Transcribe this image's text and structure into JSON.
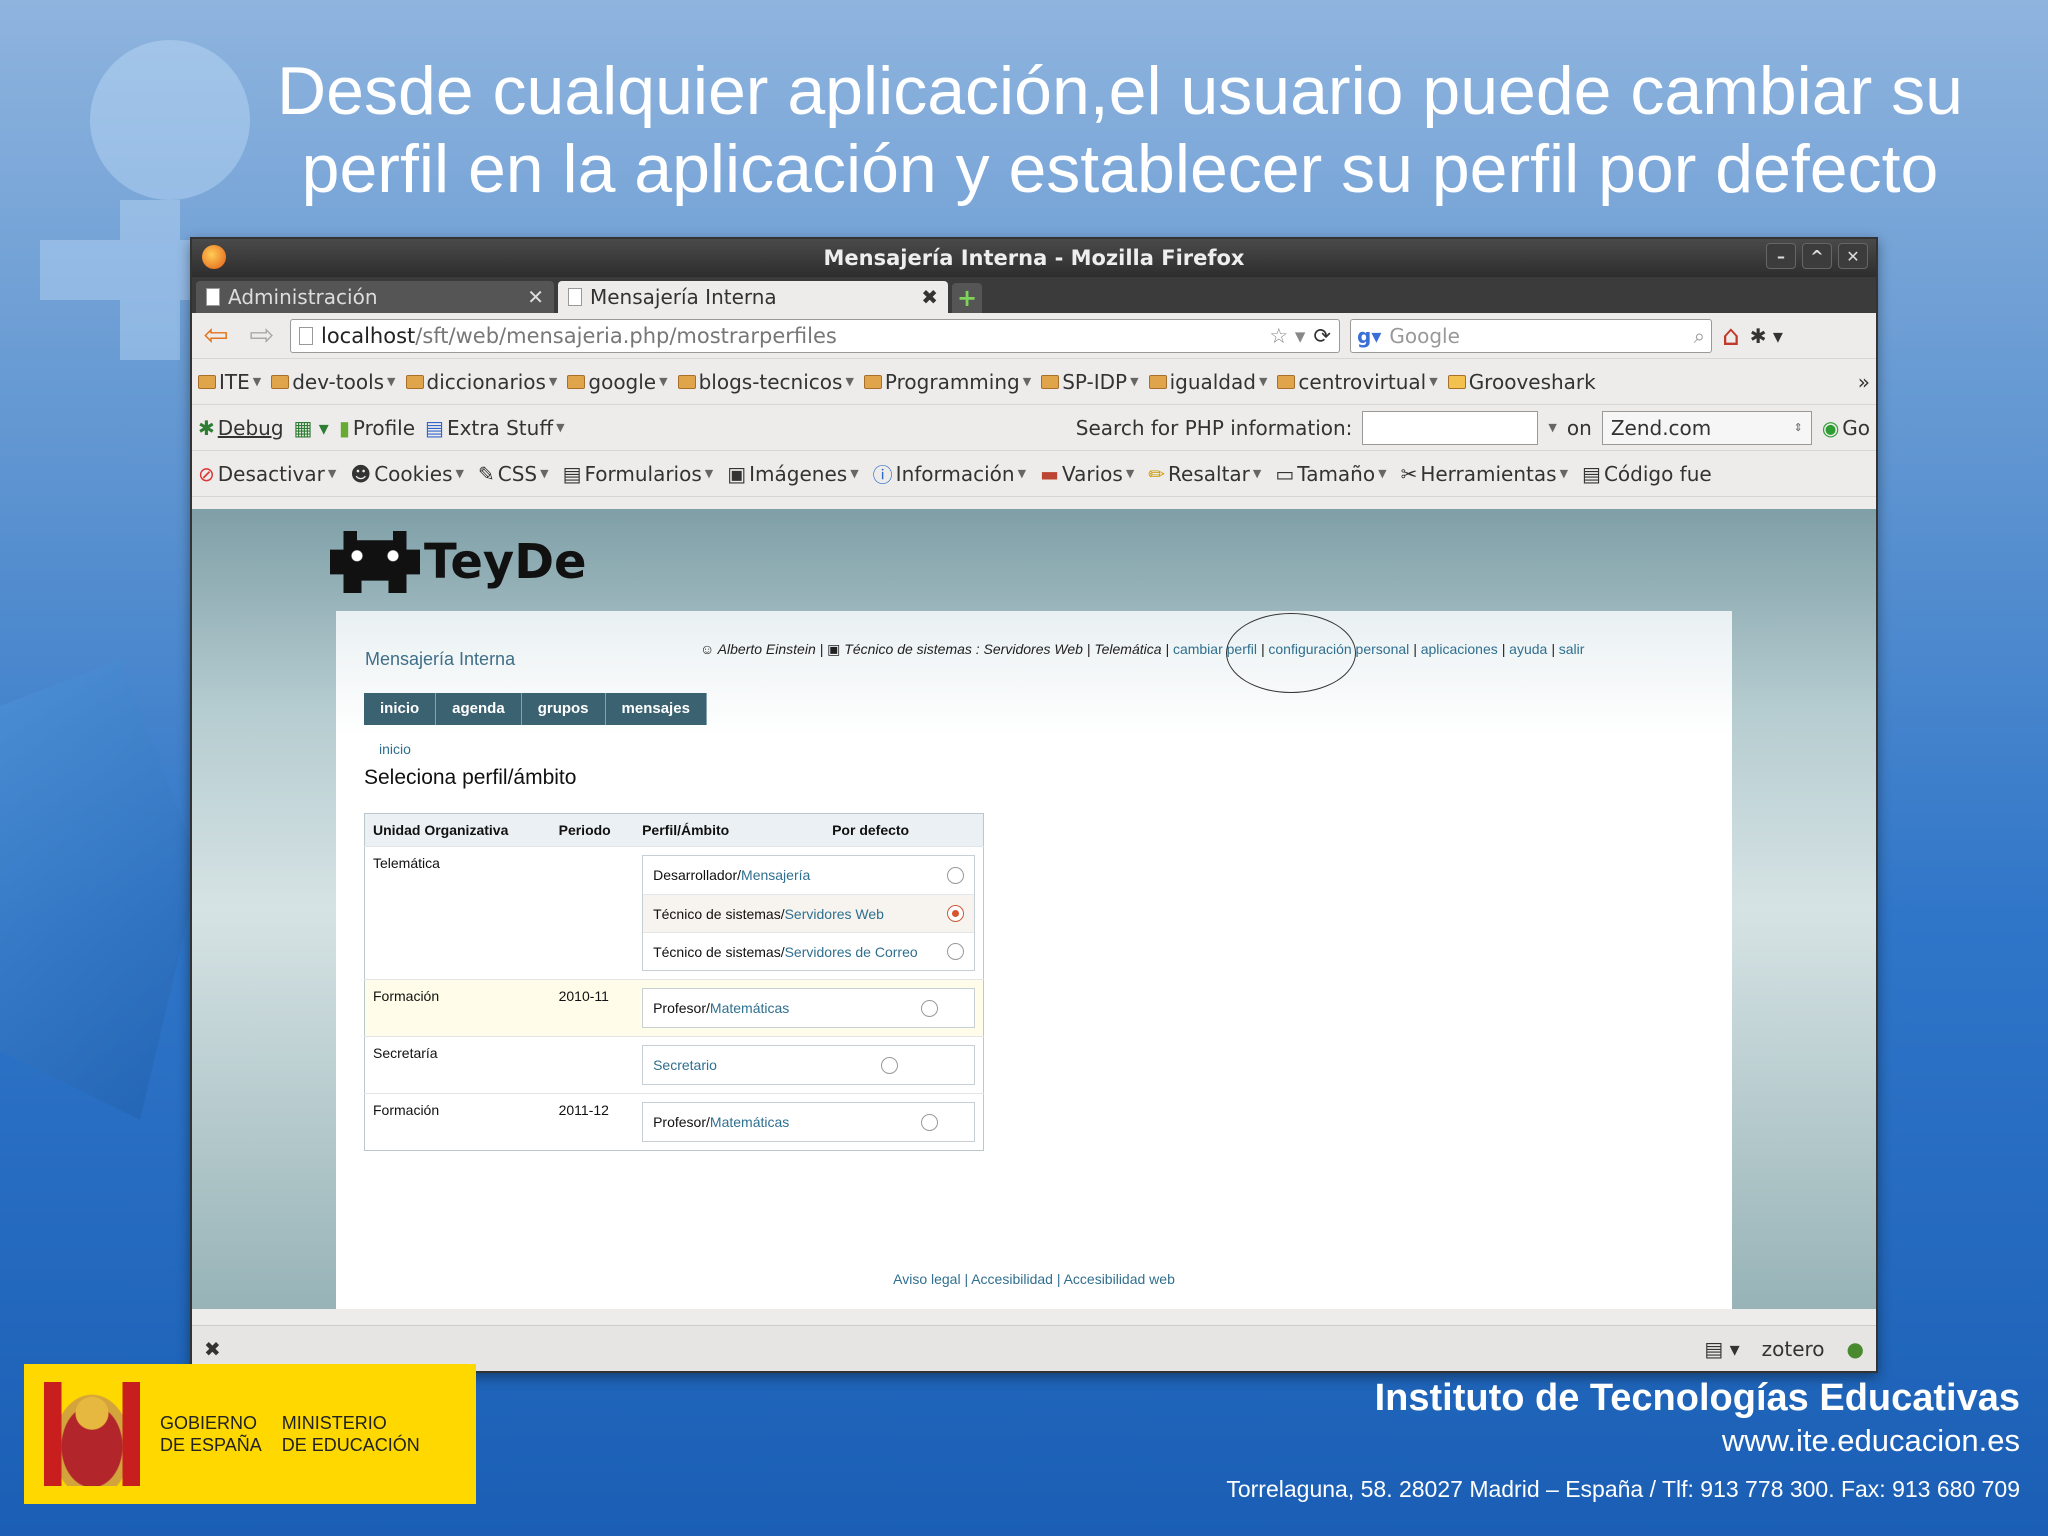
{
  "slide": {
    "title_line1": "Desde cualquier aplicación,el usuario puede cambiar su",
    "title_line2": "perfil en la aplicación y establecer su perfil por defecto"
  },
  "window": {
    "title": "Mensajería Interna - Mozilla Firefox",
    "tabs": [
      {
        "label": "Administración"
      },
      {
        "label": "Mensajería Interna"
      }
    ],
    "url_host": "localhost",
    "url_path": "/sft/web/mensajeria.php/mostrarperfiles",
    "search_placeholder": "Google"
  },
  "bookmarks": [
    "ITE",
    "dev-tools",
    "diccionarios",
    "google",
    "blogs-tecnicos",
    "Programming",
    "SP-IDP",
    "igualdad",
    "centrovirtual",
    "Grooveshark"
  ],
  "bookmarks_more": "»",
  "toolbar2": {
    "debug": "Debug",
    "profile": "Profile",
    "extra": "Extra Stuff",
    "php_label": "Search for PHP information:",
    "on_label": "on",
    "site": "Zend.com",
    "go": "Go"
  },
  "toolbar3": [
    "Desactivar",
    "Cookies",
    "CSS",
    "Formularios",
    "Imágenes",
    "Información",
    "Varios",
    "Resaltar",
    "Tamaño",
    "Herramientas",
    "Código fue"
  ],
  "app": {
    "logo_text": "TeyDe",
    "name": "Mensajería Interna",
    "user_name": "Alberto Einstein",
    "user_profile": "Técnico de sistemas : Servidores Web",
    "user_unit": "Telemática",
    "links": [
      "cambiar perfil",
      "configuración personal",
      "aplicaciones",
      "ayuda",
      "salir"
    ],
    "nav": [
      "inicio",
      "agenda",
      "grupos",
      "mensajes"
    ],
    "breadcrumb": "inicio",
    "heading": "Seleciona perfil/ámbito",
    "table_headers": [
      "Unidad Organizativa",
      "Periodo",
      "Perfil/Ámbito",
      "Por defecto"
    ],
    "rows": [
      {
        "unit": "Telemática",
        "period": "",
        "options": [
          {
            "role": "Desarrollador/",
            "scope": "Mensajería",
            "selected": false
          },
          {
            "role": "Técnico de sistemas/",
            "scope": "Servidores Web",
            "selected": true
          },
          {
            "role": "Técnico de sistemas/",
            "scope": "Servidores de Correo",
            "selected": false
          }
        ]
      },
      {
        "unit": "Formación",
        "period": "2010-11",
        "options": [
          {
            "role": "Profesor/",
            "scope": "Matemáticas",
            "selected": false
          }
        ]
      },
      {
        "unit": "Secretaría",
        "period": "",
        "options": [
          {
            "role": "",
            "scope": "Secretario",
            "selected": false
          }
        ]
      },
      {
        "unit": "Formación",
        "period": "2011-12",
        "options": [
          {
            "role": "Profesor/",
            "scope": "Matemáticas",
            "selected": false
          }
        ]
      }
    ],
    "footer": "Aviso legal | Accesibilidad | Accesibilidad web"
  },
  "statusbar": {
    "zotero": "zotero"
  },
  "gov": {
    "line1a": "GOBIERNO",
    "line1b": "DE ESPAÑA",
    "line2a": "MINISTERIO",
    "line2b": "DE EDUCACIÓN"
  },
  "institute": {
    "name": "Instituto de Tecnologías Educativas",
    "url": "www.ite.educacion.es",
    "address": "Torrelaguna, 58. 28027 Madrid – España / Tlf: 913 778 300. Fax: 913 680 709"
  },
  "colors": {
    "accent": "#2f6f8f",
    "nav": "#3b6270",
    "gov_yellow": "#ffd800"
  }
}
